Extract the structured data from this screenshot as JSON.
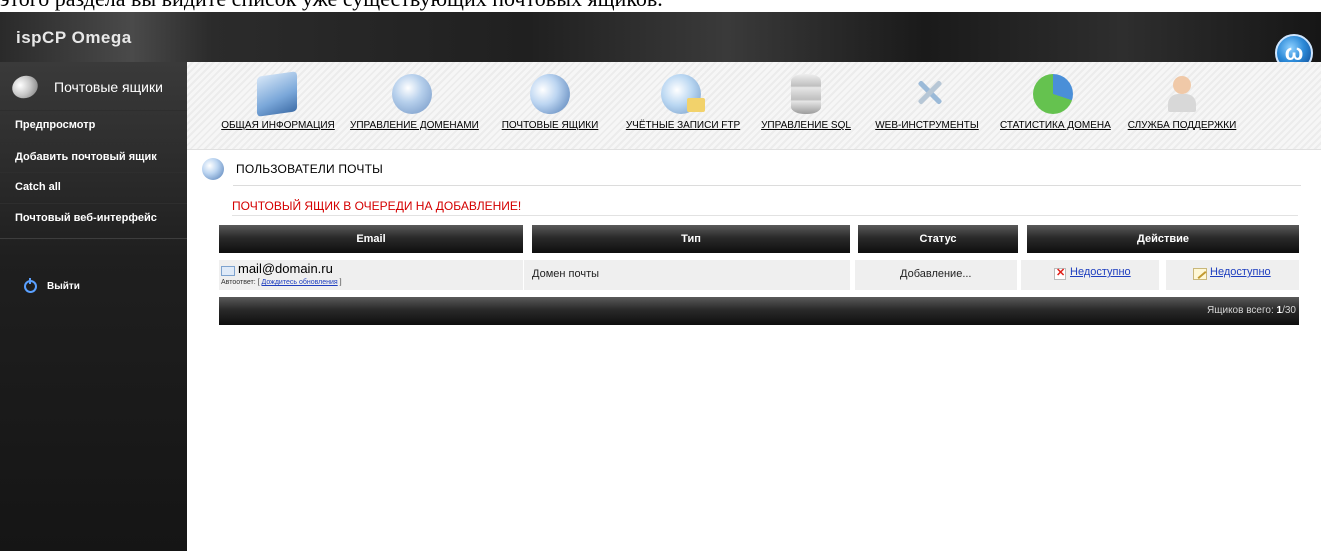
{
  "caption": "этого раздела вы видите список уже существующих почтовых ящиков.",
  "app": {
    "logo": "ispCP Omega",
    "badge": "ω"
  },
  "sidebar": {
    "header": "Почтовые ящики",
    "items": [
      {
        "label": "Предпросмотр"
      },
      {
        "label": "Добавить почтовый ящик"
      },
      {
        "label": "Catch all"
      },
      {
        "label": "Почтовый веб-интерфейс"
      }
    ],
    "logout": "Выйти"
  },
  "nav": [
    {
      "label": "Общая информация",
      "icon": "general-info-icon"
    },
    {
      "label": "Управление доменами",
      "icon": "globe-icon"
    },
    {
      "label": "Почтовые ящики",
      "icon": "mail-icon"
    },
    {
      "label": "Учётные записи FTP",
      "icon": "ftp-folder-icon"
    },
    {
      "label": "Управление SQL",
      "icon": "database-icon"
    },
    {
      "label": "Web-инструменты",
      "icon": "tools-icon"
    },
    {
      "label": "Статистика домена",
      "icon": "pie-chart-icon"
    },
    {
      "label": "Служба поддержки",
      "icon": "support-person-icon"
    }
  ],
  "main": {
    "section_title": "Пользователи почты",
    "alert": "Почтовый ящик в очереди на добавление!",
    "table": {
      "headers": [
        "Email",
        "Тип",
        "Статус",
        "Действие"
      ],
      "rows": [
        {
          "email": "mail@domain.ru",
          "autoreply_label": "Автоответ:",
          "autoreply_open": "[",
          "autoreply_link": "Дождитесь обновления",
          "autoreply_close": "]",
          "type": "Домен почты",
          "status": "Добавление...",
          "action_delete": "Недоступно",
          "action_edit": "Недоступно"
        }
      ],
      "total_label": "Ящиков всего:",
      "total_current": "1",
      "total_max": "/30"
    }
  },
  "colors": {
    "alert": "#d40000",
    "link": "#1f3fbf"
  }
}
